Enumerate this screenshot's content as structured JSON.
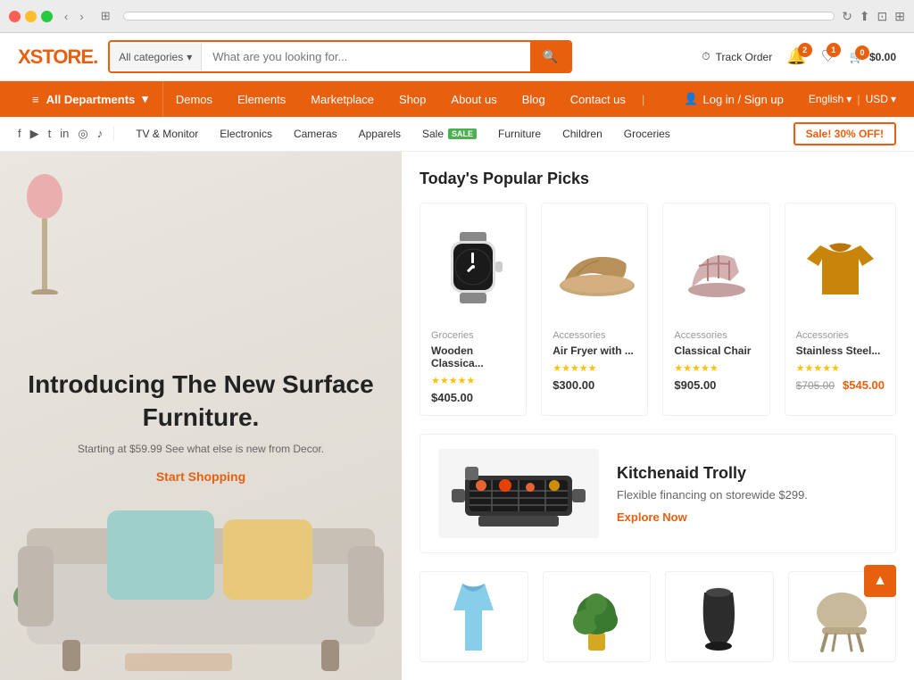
{
  "browser": {
    "dots": [
      "red",
      "yellow",
      "green"
    ],
    "address": "",
    "reload_icon": "↻"
  },
  "header": {
    "logo": "XSTORE.",
    "search": {
      "category": "All categories",
      "placeholder": "What are you looking for...",
      "icon": "🔍"
    },
    "track_order": "Track Order",
    "wishlist_count": "1",
    "notifications_count": "2",
    "cart_count": "0",
    "cart_total": "$0.00"
  },
  "navbar": {
    "all_departments": "All Departments",
    "links": [
      "Demos",
      "Elements",
      "Marketplace",
      "Shop",
      "About us",
      "Blog",
      "Contact us"
    ],
    "login": "Log in / Sign up",
    "language": "English",
    "currency": "USD"
  },
  "social": {
    "icons": [
      "f",
      "▶",
      "t",
      "in",
      "◎",
      "♪"
    ]
  },
  "categories": {
    "links": [
      "TV & Monitor",
      "Electronics",
      "Cameras",
      "Apparels",
      "Sale",
      "Furniture",
      "Children",
      "Groceries"
    ],
    "sale_label": "SALE",
    "sale_button": "Sale! 30% OFF!"
  },
  "hero": {
    "title": "Introducing The New Surface Furniture.",
    "subtitle": "Starting at $59.99 See what else is new from Decor.",
    "cta": "Start Shopping"
  },
  "popular_picks": {
    "title": "Today's Popular Picks",
    "products": [
      {
        "category": "Groceries",
        "name": "Wooden Classica...",
        "stars": 5,
        "price": "$405.00",
        "original_price": null,
        "sale_price": null
      },
      {
        "category": "Accessories",
        "name": "Air Fryer with ...",
        "stars": 5,
        "price": "$300.00",
        "original_price": null,
        "sale_price": null
      },
      {
        "category": "Accessories",
        "name": "Classical Chair",
        "stars": 5,
        "price": "$905.00",
        "original_price": null,
        "sale_price": null
      },
      {
        "category": "Accessories",
        "name": "Stainless Steel...",
        "stars": 5,
        "price": null,
        "original_price": "$705.00",
        "sale_price": "$545.00"
      }
    ]
  },
  "promo": {
    "title": "Kitchenaid Trolly",
    "subtitle": "Flexible financing on storewide $299.",
    "cta": "Explore Now"
  },
  "bottom_products": [
    {
      "name": "Dress"
    },
    {
      "name": "Plant"
    },
    {
      "name": "Vase"
    },
    {
      "name": "Chair"
    }
  ]
}
